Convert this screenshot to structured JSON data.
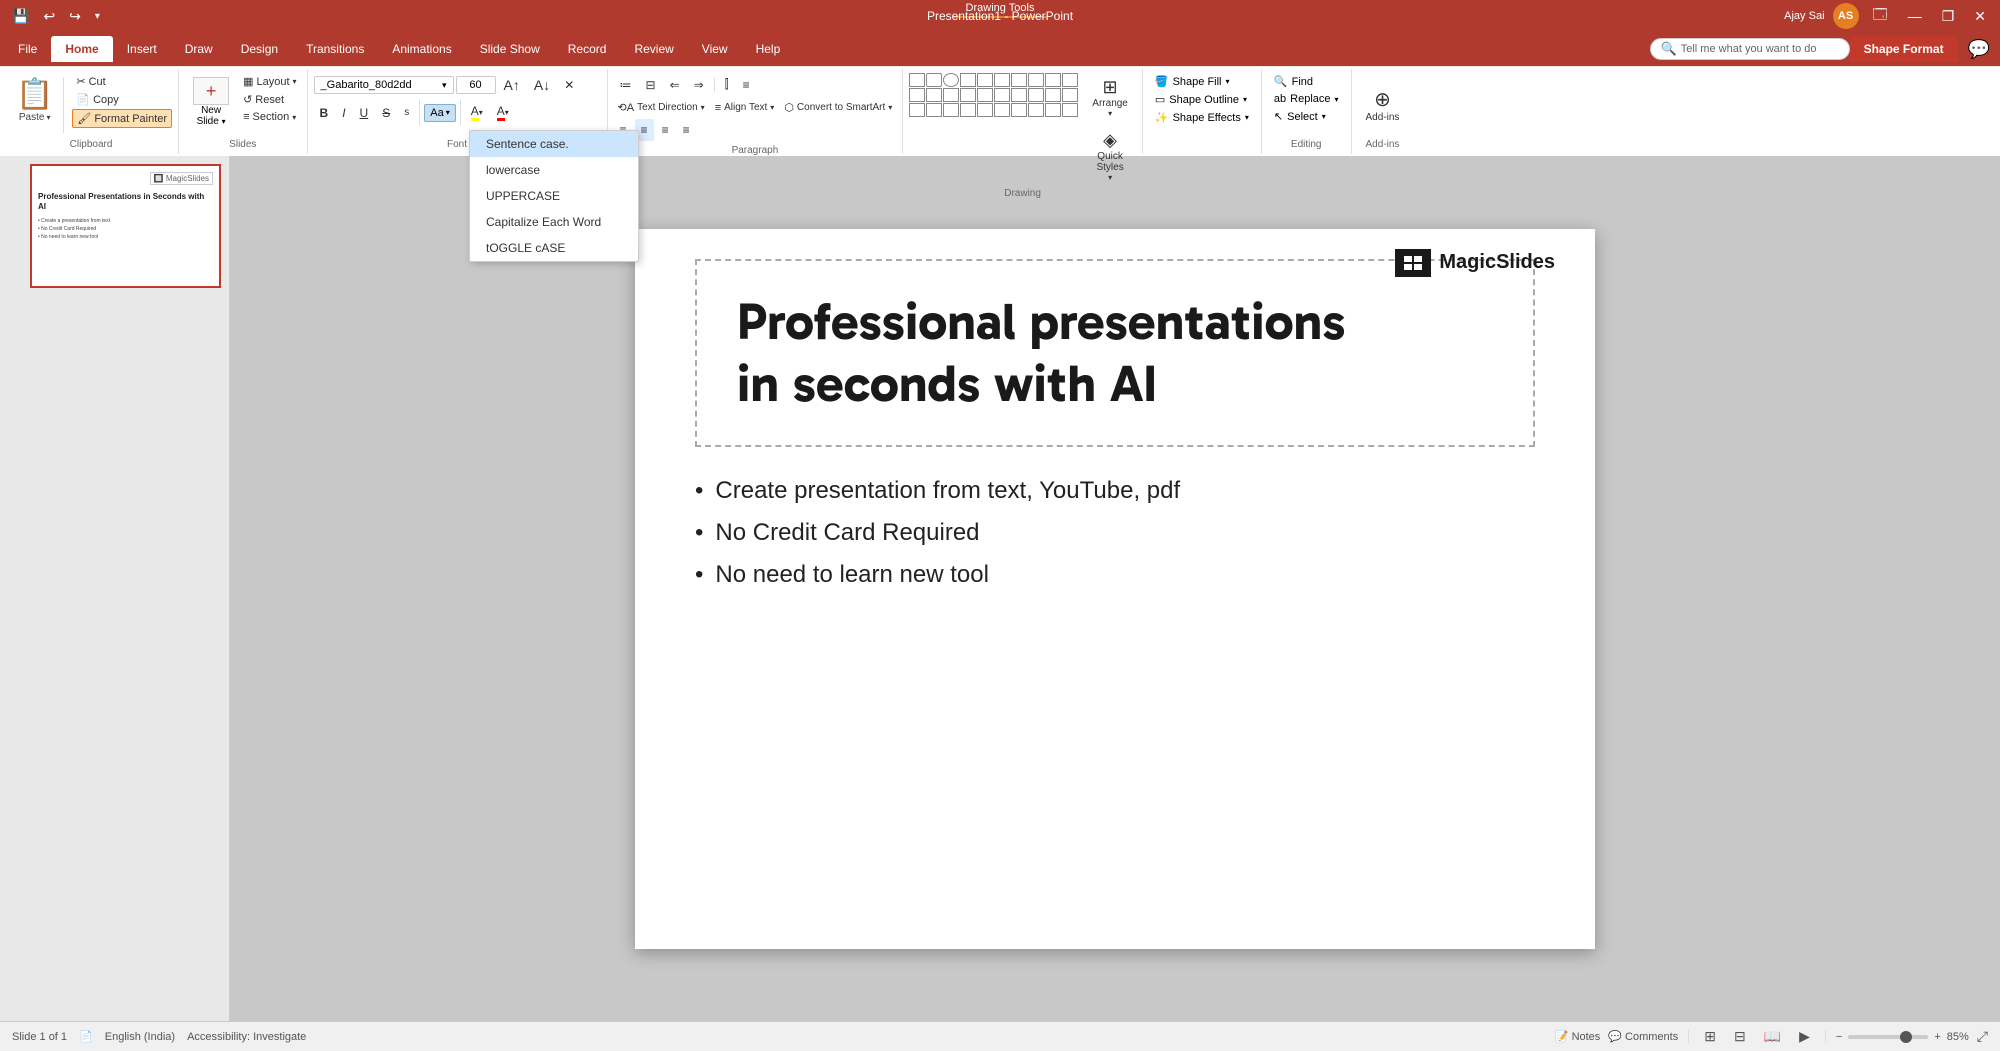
{
  "titlebar": {
    "app_name": "Presentation1 - PowerPoint",
    "drawing_tools": "Drawing Tools",
    "user_name": "Ajay Sai",
    "user_initials": "AS",
    "minimize": "—",
    "restore": "❐",
    "close": "✕",
    "quick_save": "💾",
    "undo": "↩",
    "redo": "↪"
  },
  "tabs": [
    {
      "label": "File",
      "active": false
    },
    {
      "label": "Home",
      "active": true
    },
    {
      "label": "Insert",
      "active": false
    },
    {
      "label": "Draw",
      "active": false
    },
    {
      "label": "Design",
      "active": false
    },
    {
      "label": "Transitions",
      "active": false
    },
    {
      "label": "Animations",
      "active": false
    },
    {
      "label": "Slide Show",
      "active": false
    },
    {
      "label": "Record",
      "active": false
    },
    {
      "label": "Review",
      "active": false
    },
    {
      "label": "View",
      "active": false
    },
    {
      "label": "Help",
      "active": false
    },
    {
      "label": "Shape Format",
      "active": false,
      "special": true
    }
  ],
  "ribbon": {
    "clipboard": {
      "label": "Clipboard",
      "paste": "Paste",
      "cut": "Cut",
      "copy": "Copy",
      "format_painter": "Format Painter"
    },
    "slides": {
      "label": "Slides",
      "new_slide": "New\nSlide",
      "layout": "Layout",
      "reset": "Reset",
      "section": "Section"
    },
    "font": {
      "label": "Font",
      "font_name": "_Gabarito_80d2dd",
      "font_size": "60",
      "bold": "B",
      "italic": "I",
      "underline": "U",
      "strikethrough": "S",
      "shadow": "s",
      "clear_format": "✕",
      "change_case": "Aa",
      "text_highlight": "A",
      "font_color": "A"
    },
    "paragraph": {
      "label": "Paragraph",
      "bullets": "≡",
      "numbering": "≡",
      "decrease_indent": "⇐",
      "increase_indent": "⇒",
      "text_direction": "Text Direction",
      "align_text": "Align Text",
      "convert_smartart": "Convert to SmartArt",
      "align_left": "≡",
      "align_center": "≡",
      "align_right": "≡",
      "justify": "≡",
      "columns": "≡"
    },
    "drawing": {
      "label": "Drawing"
    },
    "editing": {
      "label": "Editing",
      "find": "Find",
      "replace": "Replace",
      "select": "Select"
    },
    "shape_format": {
      "label": "",
      "shape_fill": "Shape Fill",
      "shape_outline": "Shape Outline",
      "shape_effects": "Shape Effects",
      "arrange": "Arrange",
      "quick_styles": "Quick Styles",
      "select": "Select"
    },
    "addins": {
      "label": "Add-ins",
      "addins": "Add-ins"
    }
  },
  "change_case_dropdown": {
    "items": [
      {
        "label": "Sentence case.",
        "highlighted": true
      },
      {
        "label": "lowercase"
      },
      {
        "label": "UPPERCASE"
      },
      {
        "label": "Capitalize Each Word"
      },
      {
        "label": "tOGGLE cASE"
      }
    ]
  },
  "tell_me": "Tell me what you want to do",
  "slide": {
    "number": "1",
    "title": "Professional presentations\nin seconds with AI",
    "bullets": [
      "Create presentation from text, YouTube, pdf",
      "No Credit Card Required",
      "No need to learn new tool"
    ],
    "logo_text": "MagicSlides"
  },
  "thumbnail": {
    "title": "Professional Presentations in Seconds with AI",
    "bullets": [
      "Create a presentation from text",
      "No Credit Card Required",
      "No need to learn new tool"
    ]
  },
  "status": {
    "slide_info": "Slide 1 of 1",
    "language": "English (India)",
    "accessibility": "Accessibility: Investigate",
    "notes": "Notes",
    "comments": "Comments",
    "zoom": "85%",
    "zoom_value": 85
  }
}
